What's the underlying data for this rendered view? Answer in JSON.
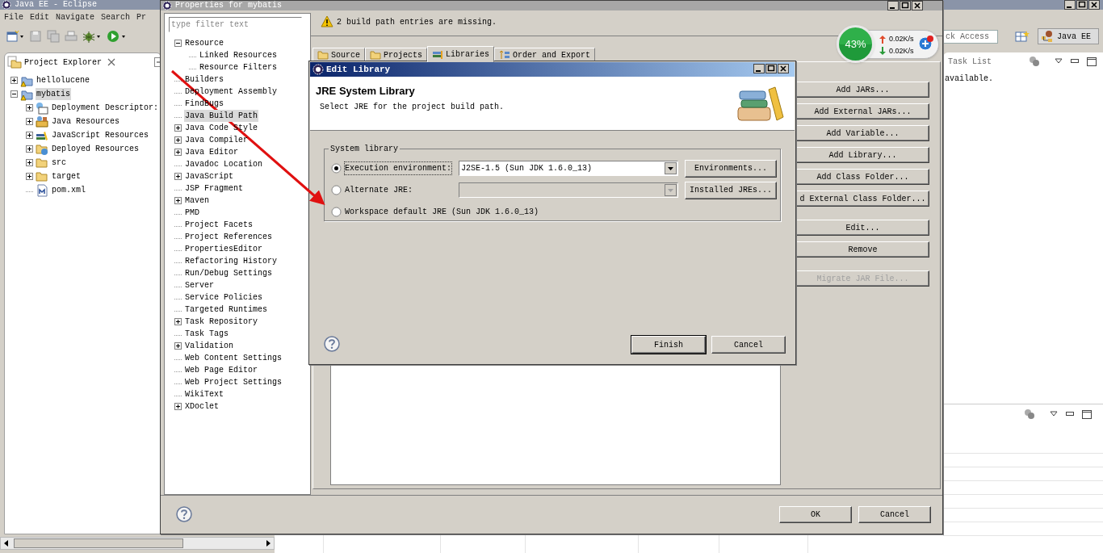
{
  "eclipse_window": {
    "title": "Java EE - Eclipse",
    "menu": [
      "File",
      "Edit",
      "Navigate",
      "Search",
      "Pr"
    ],
    "quick_access": {
      "placeholder": "ck Access"
    },
    "perspective": "Java EE"
  },
  "project_explorer": {
    "title": "Project Explorer",
    "tree": [
      {
        "label": "hellolucene",
        "kind": "node",
        "expanded": false,
        "selected": false
      },
      {
        "label": "mybatis",
        "kind": "node",
        "expanded": true,
        "selected": true,
        "children": [
          {
            "label": "Deployment Descriptor:",
            "kind": "node",
            "expanded": false,
            "selected": false
          },
          {
            "label": "Java Resources",
            "kind": "node",
            "expanded": false,
            "selected": false
          },
          {
            "label": "JavaScript Resources",
            "kind": "node",
            "expanded": false,
            "selected": false
          },
          {
            "label": "Deployed Resources",
            "kind": "node",
            "expanded": false,
            "selected": false
          },
          {
            "label": "src",
            "kind": "node",
            "expanded": false,
            "selected": false
          },
          {
            "label": "target",
            "kind": "node",
            "expanded": false,
            "selected": false
          },
          {
            "label": "pom.xml",
            "kind": "leaf",
            "selected": false
          }
        ]
      }
    ]
  },
  "task_list": {
    "title": "Task List",
    "message": "available."
  },
  "net_monitor": {
    "percent": "43%",
    "upload": "0.02K/s",
    "download": "0.02K/s"
  },
  "properties_dialog": {
    "title": "Properties for mybatis",
    "filter": {
      "placeholder": "type filter text"
    },
    "tree": [
      {
        "label": "Resource",
        "kind": "node",
        "expanded": true,
        "selected": false,
        "children": [
          {
            "label": "Linked Resources",
            "kind": "leaf",
            "selected": false
          },
          {
            "label": "Resource Filters",
            "kind": "leaf",
            "selected": false
          }
        ]
      },
      {
        "label": "Builders",
        "kind": "leaf",
        "selected": false
      },
      {
        "label": "Deployment Assembly",
        "kind": "leaf",
        "selected": false
      },
      {
        "label": "FindBugs",
        "kind": "leaf",
        "selected": false
      },
      {
        "label": "Java Build Path",
        "kind": "leaf",
        "selected": true
      },
      {
        "label": "Java Code Style",
        "kind": "node",
        "expanded": false,
        "selected": false
      },
      {
        "label": "Java Compiler",
        "kind": "node",
        "expanded": false,
        "selected": false
      },
      {
        "label": "Java Editor",
        "kind": "node",
        "expanded": false,
        "selected": false
      },
      {
        "label": "Javadoc Location",
        "kind": "leaf",
        "selected": false
      },
      {
        "label": "JavaScript",
        "kind": "node",
        "expanded": false,
        "selected": false
      },
      {
        "label": "JSP Fragment",
        "kind": "leaf",
        "selected": false
      },
      {
        "label": "Maven",
        "kind": "node",
        "expanded": false,
        "selected": false
      },
      {
        "label": "PMD",
        "kind": "leaf",
        "selected": false
      },
      {
        "label": "Project Facets",
        "kind": "leaf",
        "selected": false
      },
      {
        "label": "Project References",
        "kind": "leaf",
        "selected": false
      },
      {
        "label": "PropertiesEditor",
        "kind": "leaf",
        "selected": false
      },
      {
        "label": "Refactoring History",
        "kind": "leaf",
        "selected": false
      },
      {
        "label": "Run/Debug Settings",
        "kind": "leaf",
        "selected": false
      },
      {
        "label": "Server",
        "kind": "leaf",
        "selected": false
      },
      {
        "label": "Service Policies",
        "kind": "leaf",
        "selected": false
      },
      {
        "label": "Targeted Runtimes",
        "kind": "leaf",
        "selected": false
      },
      {
        "label": "Task Repository",
        "kind": "node",
        "expanded": false,
        "selected": false
      },
      {
        "label": "Task Tags",
        "kind": "leaf",
        "selected": false
      },
      {
        "label": "Validation",
        "kind": "node",
        "expanded": false,
        "selected": false
      },
      {
        "label": "Web Content Settings",
        "kind": "leaf",
        "selected": false
      },
      {
        "label": "Web Page Editor",
        "kind": "leaf",
        "selected": false
      },
      {
        "label": "Web Project Settings",
        "kind": "leaf",
        "selected": false
      },
      {
        "label": "WikiText",
        "kind": "leaf",
        "selected": false
      },
      {
        "label": "XDoclet",
        "kind": "node",
        "expanded": false,
        "selected": false
      }
    ],
    "message": "2 build path entries are missing.",
    "tabs": [
      {
        "label": "Source",
        "selected": false
      },
      {
        "label": "Projects",
        "selected": false
      },
      {
        "label": "Libraries",
        "selected": true
      },
      {
        "label": "Order and Export",
        "selected": false
      }
    ],
    "buttons": [
      {
        "label": "Add JARs...",
        "disabled": false
      },
      {
        "label": "Add External JARs...",
        "disabled": false
      },
      {
        "label": "Add Variable...",
        "disabled": false
      },
      {
        "label": "Add Library...",
        "disabled": false
      },
      {
        "label": "Add Class Folder...",
        "disabled": false
      },
      {
        "label": "d External Class Folder...",
        "disabled": false
      },
      {
        "label": "Edit...",
        "disabled": false
      },
      {
        "label": "Remove",
        "disabled": false
      },
      {
        "label": "Migrate JAR File...",
        "disabled": true
      }
    ],
    "footer_buttons": [
      "OK",
      "Cancel"
    ]
  },
  "edit_library_dialog": {
    "title": "Edit Library",
    "heading": "JRE System Library",
    "description": "Select JRE for the project build path.",
    "group": "System library",
    "options": [
      {
        "label": "Execution environment:",
        "selected": true,
        "kind": "combo",
        "value": "J2SE-1.5 (Sun JDK 1.6.0_13)",
        "disabled": false,
        "button": "Environments..."
      },
      {
        "label": "Alternate JRE:",
        "selected": false,
        "kind": "combo",
        "disabled": true,
        "button": "Installed JREs..."
      },
      {
        "label": "Workspace default JRE (Sun JDK 1.6.0_13)",
        "selected": false,
        "kind": "plain"
      }
    ],
    "buttons": [
      "Finish",
      "Cancel"
    ]
  }
}
